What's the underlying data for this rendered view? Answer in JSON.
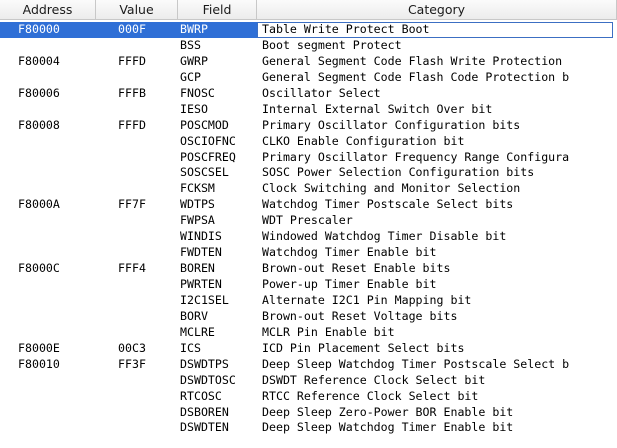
{
  "columns": {
    "address": "Address",
    "value": "Value",
    "field": "Field",
    "category": "Category"
  },
  "colors": {
    "selection": "#2f6fd6",
    "selection_border": "#3c6fc3"
  },
  "selected_row": 0,
  "rows": [
    {
      "address": "F80000",
      "value": "000F",
      "field": "BWRP",
      "category": "Table Write Protect Boot"
    },
    {
      "address": "",
      "value": "",
      "field": "BSS",
      "category": "Boot segment Protect"
    },
    {
      "address": "F80004",
      "value": "FFFD",
      "field": "GWRP",
      "category": "General Segment Code Flash Write Protection"
    },
    {
      "address": "",
      "value": "",
      "field": "GCP",
      "category": "General Segment Code Flash Code Protection b"
    },
    {
      "address": "F80006",
      "value": "FFFB",
      "field": "FNOSC",
      "category": "Oscillator Select"
    },
    {
      "address": "",
      "value": "",
      "field": "IESO",
      "category": "Internal External Switch Over bit"
    },
    {
      "address": "F80008",
      "value": "FFFD",
      "field": "POSCMOD",
      "category": "Primary Oscillator Configuration bits"
    },
    {
      "address": "",
      "value": "",
      "field": "OSCIOFNC",
      "category": "CLKO Enable Configuration bit"
    },
    {
      "address": "",
      "value": "",
      "field": "POSCFREQ",
      "category": "Primary Oscillator Frequency Range Configura"
    },
    {
      "address": "",
      "value": "",
      "field": "SOSCSEL",
      "category": "SOSC Power Selection Configuration bits"
    },
    {
      "address": "",
      "value": "",
      "field": "FCKSM",
      "category": "Clock Switching and Monitor Selection"
    },
    {
      "address": "F8000A",
      "value": "FF7F",
      "field": "WDTPS",
      "category": "Watchdog Timer Postscale Select bits"
    },
    {
      "address": "",
      "value": "",
      "field": "FWPSA",
      "category": "WDT Prescaler"
    },
    {
      "address": "",
      "value": "",
      "field": "WINDIS",
      "category": "Windowed Watchdog Timer Disable bit"
    },
    {
      "address": "",
      "value": "",
      "field": "FWDTEN",
      "category": "Watchdog Timer Enable bit"
    },
    {
      "address": "F8000C",
      "value": "FFF4",
      "field": "BOREN",
      "category": "Brown-out Reset Enable bits"
    },
    {
      "address": "",
      "value": "",
      "field": "PWRTEN",
      "category": "Power-up Timer Enable bit"
    },
    {
      "address": "",
      "value": "",
      "field": "I2C1SEL",
      "category": "Alternate I2C1 Pin Mapping bit"
    },
    {
      "address": "",
      "value": "",
      "field": "BORV",
      "category": "Brown-out Reset Voltage bits"
    },
    {
      "address": "",
      "value": "",
      "field": "MCLRE",
      "category": "MCLR Pin Enable bit"
    },
    {
      "address": "F8000E",
      "value": "00C3",
      "field": "ICS",
      "category": "ICD Pin Placement Select bits"
    },
    {
      "address": "F80010",
      "value": "FF3F",
      "field": "DSWDTPS",
      "category": "Deep Sleep Watchdog Timer Postscale Select b"
    },
    {
      "address": "",
      "value": "",
      "field": "DSWDTOSC",
      "category": "DSWDT Reference Clock Select bit"
    },
    {
      "address": "",
      "value": "",
      "field": "RTCOSC",
      "category": "RTCC Reference Clock Select bit"
    },
    {
      "address": "",
      "value": "",
      "field": "DSBOREN",
      "category": "Deep Sleep Zero-Power BOR Enable bit"
    },
    {
      "address": "",
      "value": "",
      "field": "DSWDTEN",
      "category": "Deep Sleep Watchdog Timer Enable bit"
    }
  ]
}
